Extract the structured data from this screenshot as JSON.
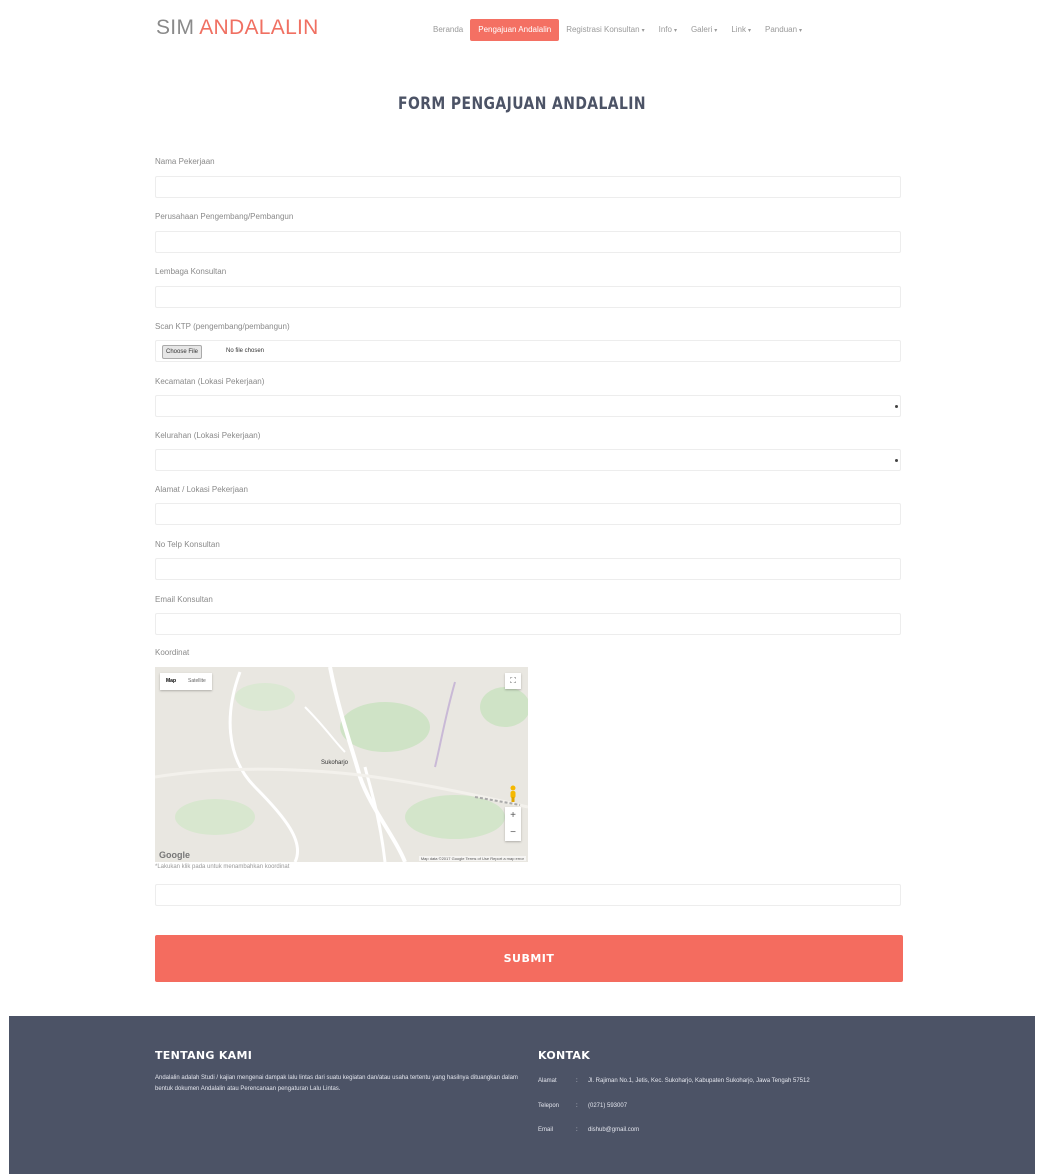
{
  "header": {
    "logo_part1": "SIM",
    "logo_part2": "ANDALALIN",
    "nav": [
      {
        "label": "Beranda",
        "dropdown": false,
        "active": false
      },
      {
        "label": "Pengajuan Andalalin",
        "dropdown": false,
        "active": true
      },
      {
        "label": "Registrasi Konsultan",
        "dropdown": true,
        "active": false
      },
      {
        "label": "Info",
        "dropdown": true,
        "active": false
      },
      {
        "label": "Galeri",
        "dropdown": true,
        "active": false
      },
      {
        "label": "Link",
        "dropdown": true,
        "active": false
      },
      {
        "label": "Panduan",
        "dropdown": true,
        "active": false
      }
    ],
    "caret": "▾"
  },
  "title": "FORM PENGAJUAN ANDALALIN",
  "form": {
    "fields": [
      {
        "label": "Nama Pekerjaan",
        "type": "text",
        "value": ""
      },
      {
        "label": "Perusahaan Pengembang/Pembangun",
        "type": "text",
        "value": ""
      },
      {
        "label": "Lembaga Konsultan",
        "type": "text",
        "value": ""
      },
      {
        "label": "Scan KTP (pengembang/pembangun)",
        "type": "file",
        "button": "Choose File",
        "file_status": "No file chosen"
      },
      {
        "label": "Kecamatan (Lokasi Pekerjaan)",
        "type": "select",
        "value": ""
      },
      {
        "label": "Kelurahan (Lokasi Pekerjaan)",
        "type": "select",
        "value": ""
      },
      {
        "label": "Alamat / Lokasi Pekerjaan",
        "type": "text",
        "value": ""
      },
      {
        "label": "No Telp Konsultan",
        "type": "text",
        "value": ""
      },
      {
        "label": "Email Konsultan",
        "type": "text",
        "value": ""
      }
    ],
    "koordinat_label": "Koordinat",
    "coordinate_value": "",
    "map": {
      "type_map": "Map",
      "type_sat": "Satellite",
      "city": "Sukoharjo",
      "logo": "Google",
      "attribution": "Map data ©2017 Google   Terms of Use   Report a map error",
      "fullscreen_icon": "⛶",
      "zoom_in": "+",
      "zoom_out": "−"
    },
    "map_hint": "*Lakukan klik pada untuk menambahkan koordinat",
    "submit_label": "SUBMIT"
  },
  "footer": {
    "about_title": "TENTANG KAMI",
    "about_text": "Andalalin adalah Studi / kajian mengenai dampak lalu lintas dari suatu kegiatan dan/atau usaha tertentu yang hasilnya dituangkan dalam bentuk dokumen Andalalin atau Perencanaan pengaturan Lalu Lintas.",
    "contact_title": "KONTAK",
    "contacts": [
      {
        "key": "Alamat",
        "sep": ":",
        "value": "Jl. Rajiman No.1, Jetis, Kec. Sukoharjo, Kabupaten Sukoharjo, Jawa Tengah 57512"
      },
      {
        "key": "Telepon",
        "sep": ":",
        "value": "(0271) 593007"
      },
      {
        "key": "Email",
        "sep": ":",
        "value": "dishub@gmail.com"
      }
    ]
  },
  "colors": {
    "accent": "#f46c5f",
    "footer_bg": "#4c5366",
    "title": "#4c5366"
  }
}
